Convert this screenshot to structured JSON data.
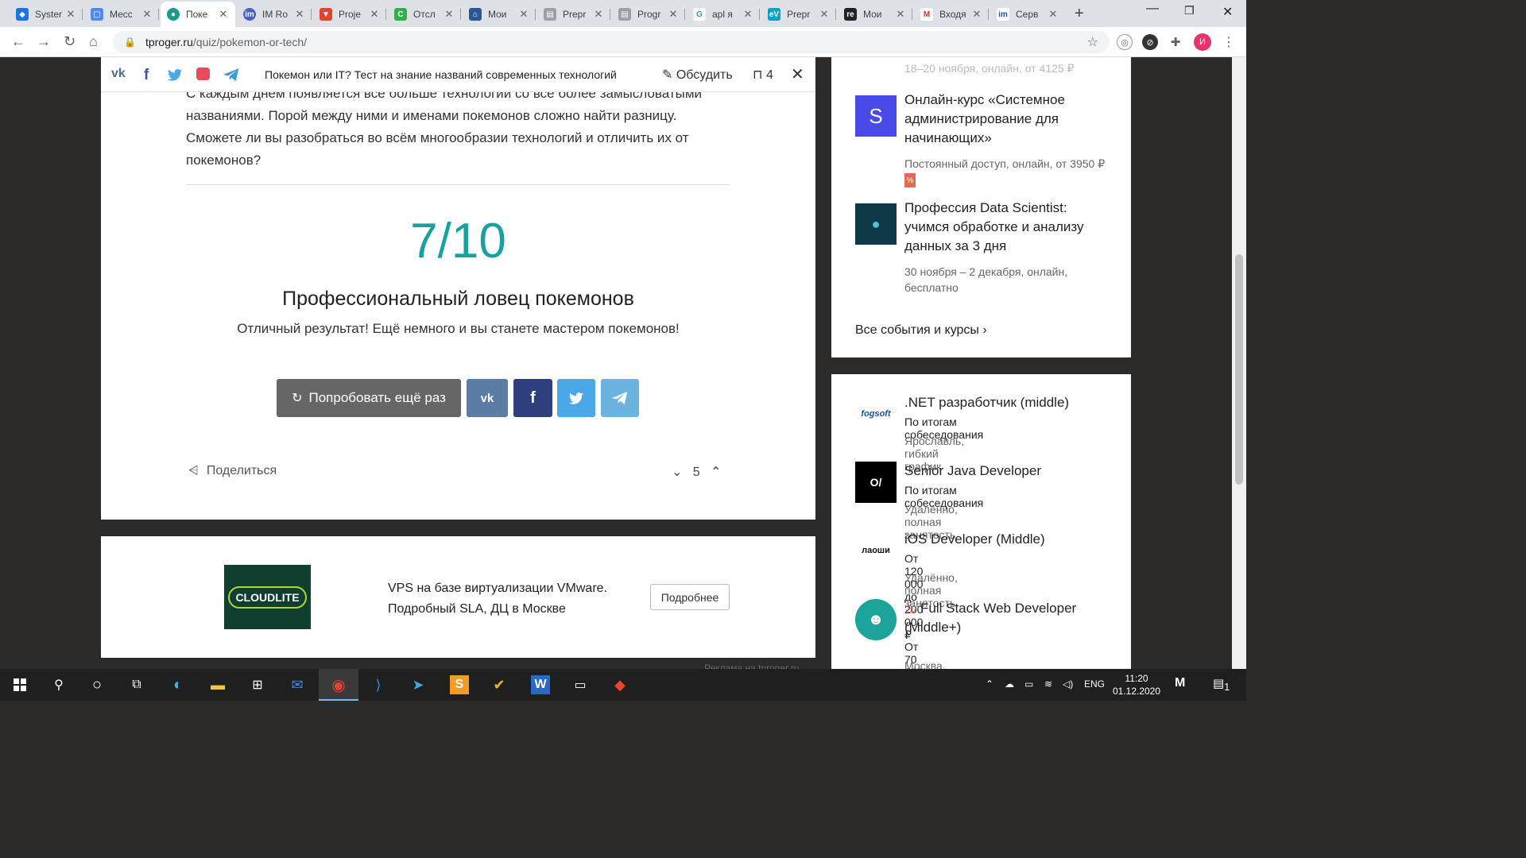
{
  "browser": {
    "tabs": [
      {
        "title": "Syster",
        "color": "#1a73e8"
      },
      {
        "title": "Месс",
        "color": "#4c8bf5"
      },
      {
        "title": "Поке",
        "color": "#1a9c8c"
      },
      {
        "title": "IM Ro",
        "color": "#4660c8"
      },
      {
        "title": "Proje",
        "color": "#e24329"
      },
      {
        "title": "Отсл",
        "color": "#2bb24c"
      },
      {
        "title": "Мои",
        "color": "#2b5797"
      },
      {
        "title": "Prepr",
        "color": "#9aa0a6"
      },
      {
        "title": "Progr",
        "color": "#9aa0a6"
      },
      {
        "title": "apl я",
        "color": "#4285f4"
      },
      {
        "title": "Prepr",
        "color": "#00a2c8"
      },
      {
        "title": "Мои",
        "color": "#222222"
      },
      {
        "title": "Входя",
        "color": "#d93025"
      },
      {
        "title": "Серв",
        "color": "#2b4ba0"
      }
    ],
    "url_domain": "tproger.ru",
    "url_path": "/quiz/pokemon-or-tech/",
    "avatar_letter": "И"
  },
  "sharebar": {
    "title": "Покемон или IT? Тест на знание названий современных технологий",
    "discuss": "Обсудить",
    "bookmarks": "4"
  },
  "quiz": {
    "intro": "С каждым днём появляется всё больше технологий со всё более замысловатыми названиями. Порой между ними и именами покемонов сложно найти разницу. Сможете ли вы разобраться во всём многообразии технологий и отличить их от покемонов?",
    "score": "7/10",
    "result_title": "Профессиональный ловец покемонов",
    "result_desc": "Отличный результат! Ещё немного и вы станете мастером покемонов!",
    "retry_label": "Попробовать ещё раз",
    "share_label": "Поделиться",
    "rating": "5"
  },
  "ad": {
    "logo_text": "CLOUDLITE",
    "text": "VPS на базе виртуализации VMware. Подробный SLA, ДЦ в Москве",
    "button": "Подробнее",
    "note": "Реклама на tproger.ru"
  },
  "events": {
    "partial_sub": "18–20 ноября, онлайн, от 4125 ₽",
    "items": [
      {
        "icon": "S",
        "title": "Онлайн-курс «Системное администрирование для начинающих»",
        "sub": "Постоянный доступ, онлайн, от 3950 ₽"
      },
      {
        "icon": "",
        "title": "Профессия Data Scientist: учимся обработке и анализу данных за 3 дня",
        "sub": "30 ноября – 2 декабря, онлайн, бесплатно"
      }
    ],
    "all_link": "Все события и курсы"
  },
  "jobs": [
    {
      "logo": "fogsoft",
      "title": ".NET разработчик (middle)",
      "salary": "По итогам собеседования",
      "location": "Ярославль, гибкий график"
    },
    {
      "logo": "O/",
      "title": "Senior Java Developer",
      "salary": "По итогам собеседования",
      "location": "Удалённо, полная занятость"
    },
    {
      "logo": "лаоши",
      "title": "iOS Developer (Middle)",
      "salary": "От 120 000 до 200 000 ₽",
      "location": "Удалённо, полная занятость"
    },
    {
      "logo": "",
      "title": "Full Stack Web Developer (Middle+)",
      "salary": "От 70 000 до 200 000 ₽",
      "location": "Москва, гибкий график"
    }
  ],
  "taskbar": {
    "lang": "ENG",
    "time": "11:20",
    "date": "01.12.2020",
    "notif": "1"
  }
}
